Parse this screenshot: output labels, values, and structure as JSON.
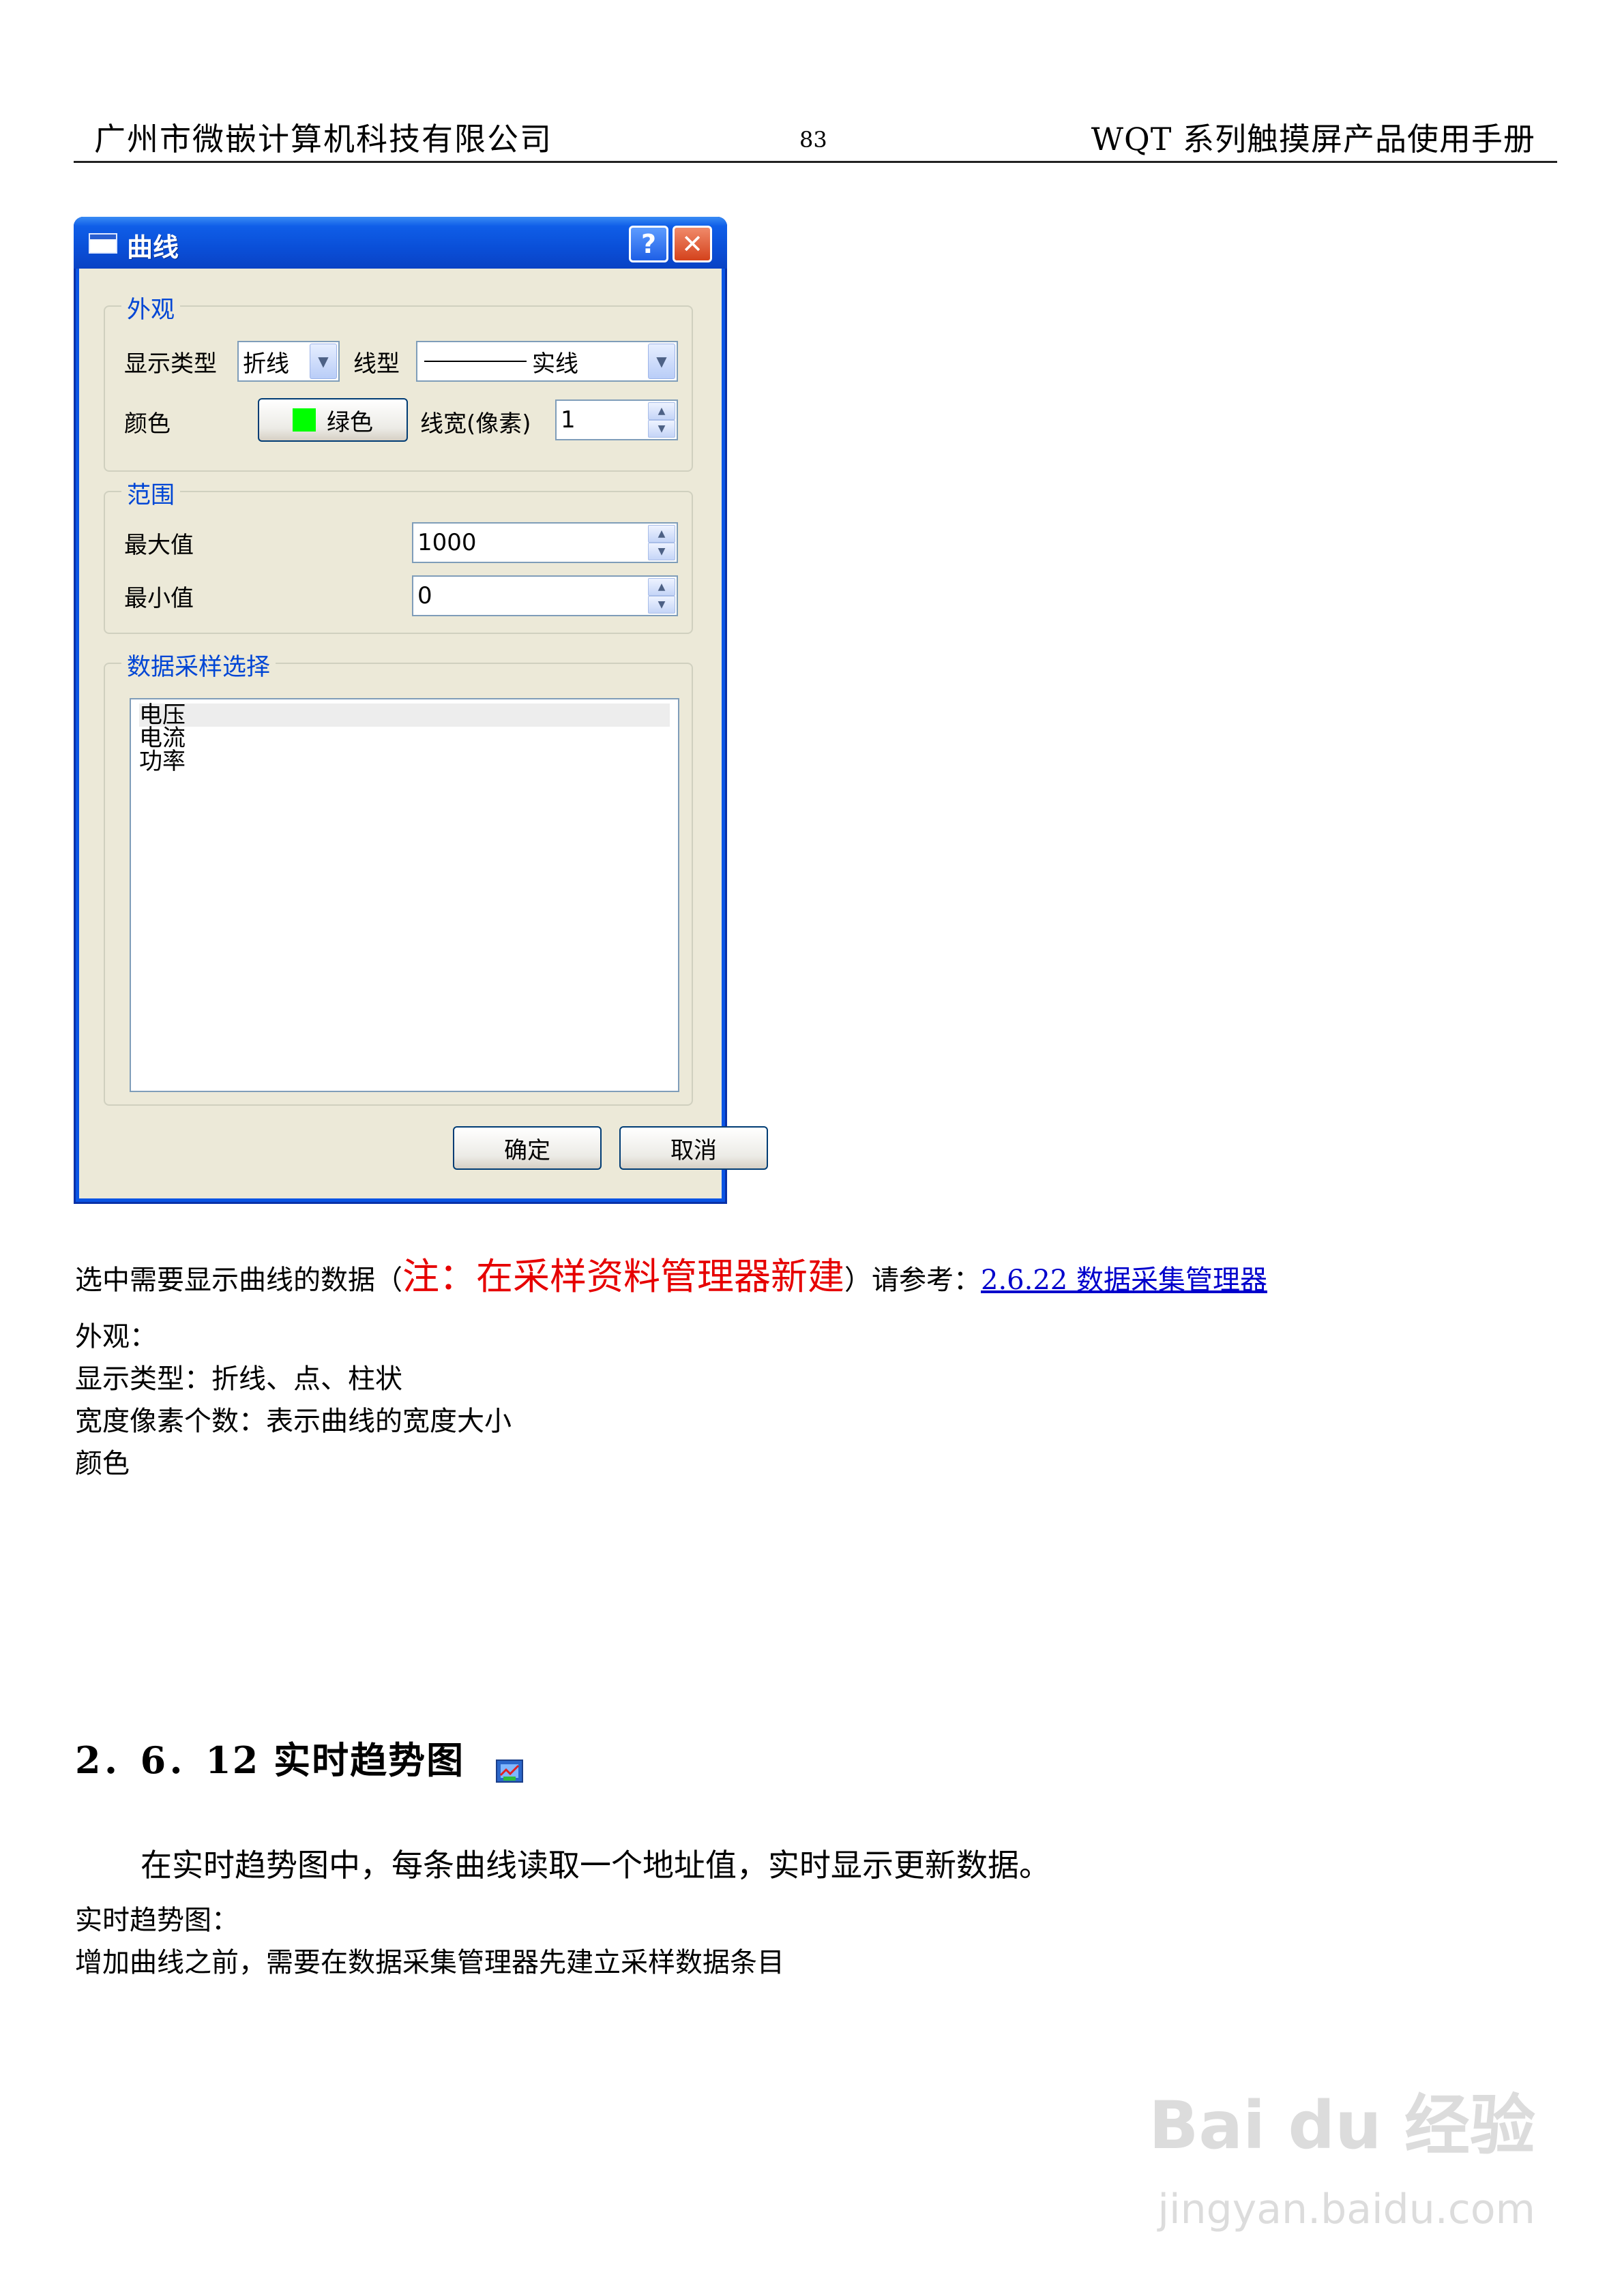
{
  "header": {
    "company": "广州市微嵌计算机科技有限公司",
    "page_number": "83",
    "manual_title": "WQT 系列触摸屏产品使用手册"
  },
  "dialog": {
    "title": "曲线",
    "help_label": "?",
    "close_label": "✕",
    "appearance": {
      "group_title": "外观",
      "display_type_label": "显示类型",
      "display_type_value": "折线",
      "line_type_label": "线型",
      "line_type_value": "实线",
      "color_label": "颜色",
      "color_button_label": "绿色",
      "color_swatch": "#00ff00",
      "line_width_label": "线宽(像素)",
      "line_width_value": "1"
    },
    "range": {
      "group_title": "范围",
      "max_label": "最大值",
      "max_value": "1000",
      "min_label": "最小值",
      "min_value": "0"
    },
    "sampling": {
      "group_title": "数据采样选择",
      "items": [
        "电压",
        "电流",
        "功率"
      ]
    },
    "ok_label": "确定",
    "cancel_label": "取消"
  },
  "body": {
    "line1_prefix": "选中需要显示曲线的数据（",
    "line1_note": "注：在采样资料管理器新建",
    "line1_suffix": "）请参考：",
    "line1_link": "2.6.22 数据采集管理器",
    "appearance_heading": "外观：",
    "display_types": "显示类型：折线、点、柱状",
    "width_desc": "宽度像素个数：表示曲线的宽度大小",
    "color_word": "颜色"
  },
  "section": {
    "title": "2．6．12  实时趋势图",
    "intro": "在实时趋势图中，每条曲线读取一个地址值，实时显示更新数据。",
    "sub_heading": "实时趋势图：",
    "note": "增加曲线之前，需要在数据采集管理器先建立采样数据条目"
  },
  "watermark": {
    "logo": "Bai du 经验",
    "url": "jingyan.baidu.com"
  }
}
